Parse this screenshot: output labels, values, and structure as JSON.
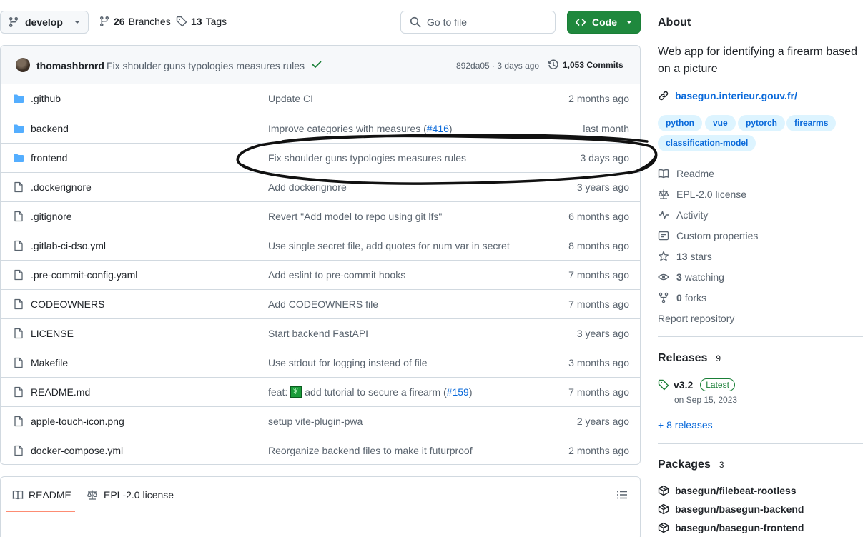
{
  "toolbar": {
    "branch": "develop",
    "branches_count": "26",
    "branches_label": "Branches",
    "tags_count": "13",
    "tags_label": "Tags",
    "goto_placeholder": "Go to file",
    "code_label": "Code"
  },
  "latest_commit": {
    "author": "thomashbrnrd",
    "message": "Fix shoulder guns typologies measures rules",
    "status": "success",
    "hash_time": "892da05 · 3 days ago",
    "commits_label": "1,053 Commits"
  },
  "files": [
    {
      "name": ".github",
      "type": "folder",
      "message": "Update CI",
      "pr": "",
      "time": "2 months ago"
    },
    {
      "name": "backend",
      "type": "folder",
      "message": "Improve categories with measures (",
      "pr": "#416",
      "after": ")",
      "time": "last month"
    },
    {
      "name": "frontend",
      "type": "folder",
      "message": "Fix shoulder guns typologies measures rules",
      "pr": "",
      "time": "3 days ago"
    },
    {
      "name": ".dockerignore",
      "type": "file",
      "message": "Add dockerignore",
      "pr": "",
      "time": "3 years ago"
    },
    {
      "name": ".gitignore",
      "type": "file",
      "message": "Revert \"Add model to repo using git lfs\"",
      "pr": "",
      "time": "6 months ago"
    },
    {
      "name": ".gitlab-ci-dso.yml",
      "type": "file",
      "message": "Use single secret file, add quotes for num var in secret",
      "pr": "",
      "time": "8 months ago"
    },
    {
      "name": ".pre-commit-config.yaml",
      "type": "file",
      "message": "Add eslint to pre-commit hooks",
      "pr": "",
      "time": "7 months ago"
    },
    {
      "name": "CODEOWNERS",
      "type": "file",
      "message": "Add CODEOWNERS file",
      "pr": "",
      "time": "7 months ago"
    },
    {
      "name": "LICENSE",
      "type": "file",
      "message": "Start backend FastAPI",
      "pr": "",
      "time": "3 years ago"
    },
    {
      "name": "Makefile",
      "type": "file",
      "message": "Use stdout for logging instead of file",
      "pr": "",
      "time": "3 months ago"
    },
    {
      "name": "README.md",
      "type": "file",
      "message": "feat:",
      "emoji": "sparkle",
      "message2": "add tutorial to secure a firearm (",
      "pr": "#159",
      "after": ")",
      "time": "7 months ago"
    },
    {
      "name": "apple-touch-icon.png",
      "type": "file",
      "message": "setup vite-plugin-pwa",
      "pr": "",
      "time": "2 years ago"
    },
    {
      "name": "docker-compose.yml",
      "type": "file",
      "message": "Reorganize backend files to make it futurproof",
      "pr": "",
      "time": "2 months ago"
    }
  ],
  "readme_tabs": {
    "readme": "README",
    "license": "EPL-2.0 license"
  },
  "about": {
    "title": "About",
    "description": "Web app for identifying a firearm based on a picture",
    "link": "basegun.interieur.gouv.fr/",
    "topics": [
      "python",
      "vue",
      "pytorch",
      "firearms",
      "classification-model"
    ],
    "items": {
      "readme": "Readme",
      "license": "EPL-2.0 license",
      "activity": "Activity",
      "custom": "Custom properties",
      "stars_count": "13",
      "stars_label": "stars",
      "watching_count": "3",
      "watching_label": "watching",
      "forks_count": "0",
      "forks_label": "forks",
      "report": "Report repository"
    }
  },
  "releases": {
    "title": "Releases",
    "count": "9",
    "latest_name": "v3.2",
    "latest_badge": "Latest",
    "latest_date": "on Sep 15, 2023",
    "more": "+ 8 releases"
  },
  "packages": {
    "title": "Packages",
    "count": "3",
    "items": [
      "basegun/filebeat-rootless",
      "basegun/basegun-backend",
      "basegun/basegun-frontend"
    ]
  },
  "colors": {
    "accent_green": "#1f883d",
    "link_blue": "#0969da",
    "folder_blue": "#54aeff",
    "topic_bg": "#ddf4ff",
    "muted": "#59636e"
  }
}
